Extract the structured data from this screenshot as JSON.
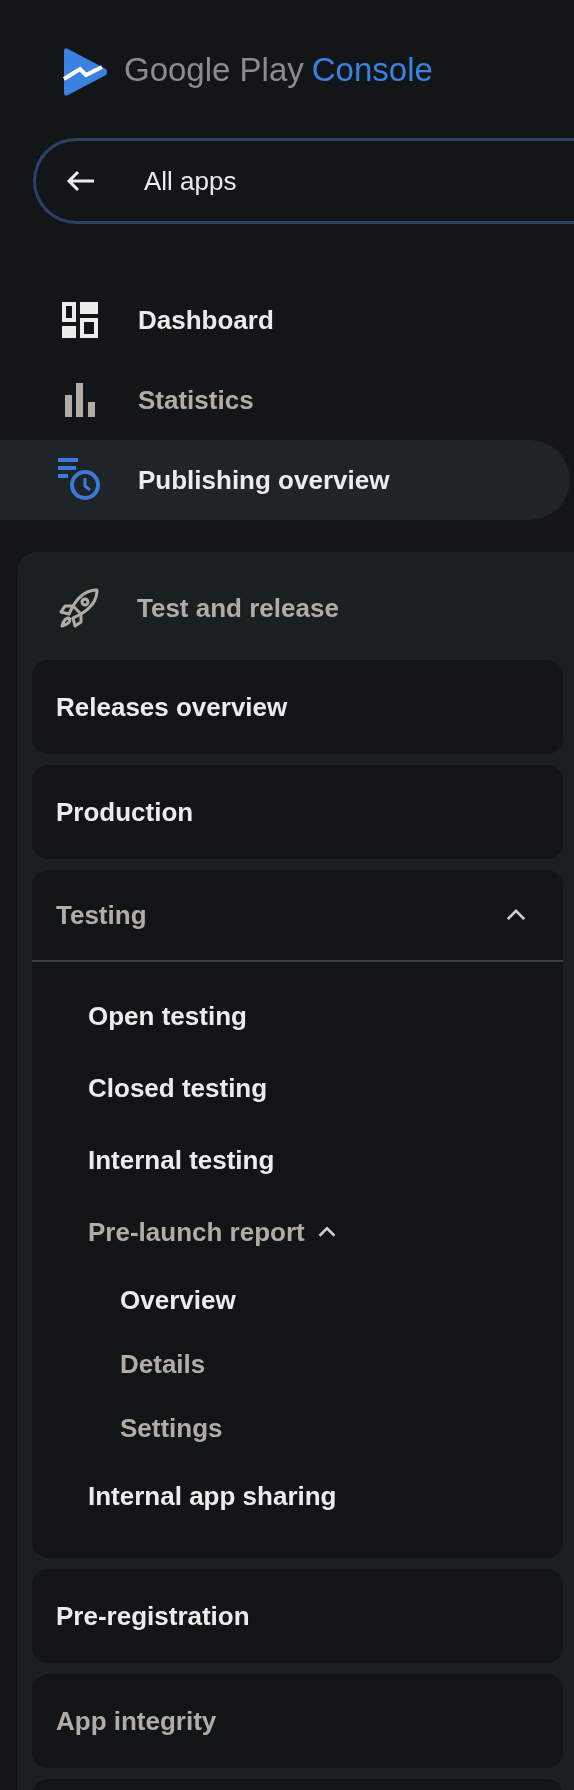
{
  "logo": {
    "text_1": "Google Play",
    "text_2": "Console"
  },
  "all_apps": {
    "label": "All apps"
  },
  "nav_items": [
    {
      "label": "Dashboard",
      "kind": "dashboard",
      "selected": false,
      "dim": false
    },
    {
      "label": "Statistics",
      "kind": "chart",
      "selected": false,
      "dim": true
    },
    {
      "label": "Publishing overview",
      "kind": "publishing",
      "selected": true,
      "dim": false
    }
  ],
  "section": {
    "label": "Test and release",
    "dim": true,
    "items": [
      {
        "label": "Releases overview",
        "dim": false
      },
      {
        "label": "Production",
        "dim": false
      },
      {
        "label": "Testing",
        "dim": true,
        "expanded": true,
        "children": [
          {
            "label": "Open testing",
            "dim": false
          },
          {
            "label": "Closed testing",
            "dim": false
          },
          {
            "label": "Internal testing",
            "dim": false
          },
          {
            "label": "Pre-launch report",
            "dim": true,
            "expanded": true,
            "children": [
              {
                "label": "Overview",
                "dim": false
              },
              {
                "label": "Details",
                "dim": true
              },
              {
                "label": "Settings",
                "dim": true
              }
            ]
          },
          {
            "label": "Internal app sharing",
            "dim": false
          }
        ]
      },
      {
        "label": "Pre-registration",
        "dim": false
      },
      {
        "label": "App integrity",
        "dim": true
      }
    ]
  }
}
